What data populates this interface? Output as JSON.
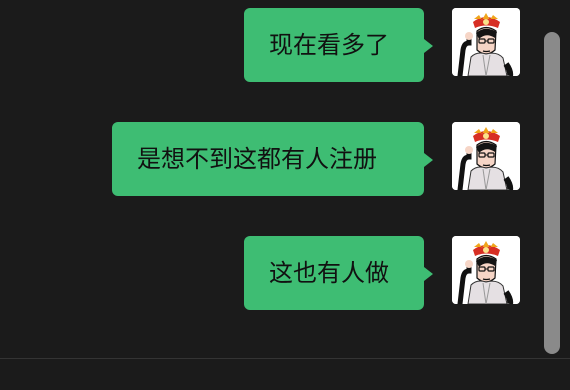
{
  "messages": [
    {
      "text": "现在看多了",
      "sender": "self"
    },
    {
      "text": "是想不到这都有人注册",
      "sender": "self"
    },
    {
      "text": "这也有人做",
      "sender": "self"
    }
  ],
  "colors": {
    "background": "#1b1b1b",
    "bubble": "#3ebd73",
    "text": "#111111",
    "scrollbar": "#8a8a8a",
    "divider": "#343434"
  },
  "icons": {
    "avatar": "cartoon-avatar-icon",
    "scrollbar": "vertical-scrollbar-icon"
  }
}
